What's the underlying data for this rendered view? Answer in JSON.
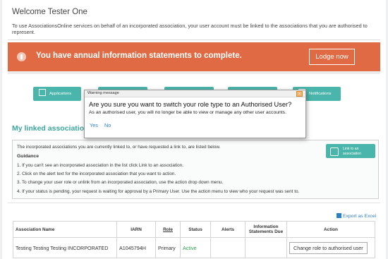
{
  "welcome": "Welcome Tester One",
  "intro": "To use AssociationsOnline services on behalf of an incorporated association, your user account must be linked to the associations that you are authorised to represent.",
  "banner": {
    "message": "You have annual information statements to complete.",
    "button": "Lodge now"
  },
  "tiles": [
    "Applications",
    "",
    "",
    "",
    "Notifications"
  ],
  "linked_title": "My linked associations",
  "info": {
    "intro": "The incorporated associations you are currently linked to, or have requested a link to, are listed below.",
    "guidance_title": "Guidance",
    "steps": [
      "1. If you can't see an incorporated association in the list click Link to an association.",
      "2. Click on the alert text for the incorporated association that you want to action.",
      "3. To change your user role or unlink from an incorporated association, use the action drop down menu.",
      "4. If your status is pending, your request is waiting for approval by a Primary User. Use the action menu to view who your request was sent to."
    ],
    "link_button": "Link to an association"
  },
  "export": "Export as Excel",
  "table": {
    "headers": [
      "Association Name",
      "IARN",
      "Role",
      "Status",
      "Alerts",
      "Information Statements Due",
      "Action"
    ],
    "row": {
      "name": "Testing Testing Testing INCORPORATED",
      "iarn": "A1045794H",
      "role": "Primary",
      "status": "Active",
      "alerts": "",
      "due": "",
      "action": "Change role to authorised user"
    }
  },
  "dialog": {
    "title": "Warning message",
    "close": "x",
    "question": "Are you sure you want to switch your role type to an Authorised User?",
    "detail": "As an authorised user, you will no longer be able to view or manage any other user accounts.",
    "yes": "Yes",
    "no": "No"
  },
  "colors": {
    "banner": "#e06a43",
    "accent": "#4ab5aa",
    "link": "#2d7fc5",
    "active": "#2aa14a"
  }
}
